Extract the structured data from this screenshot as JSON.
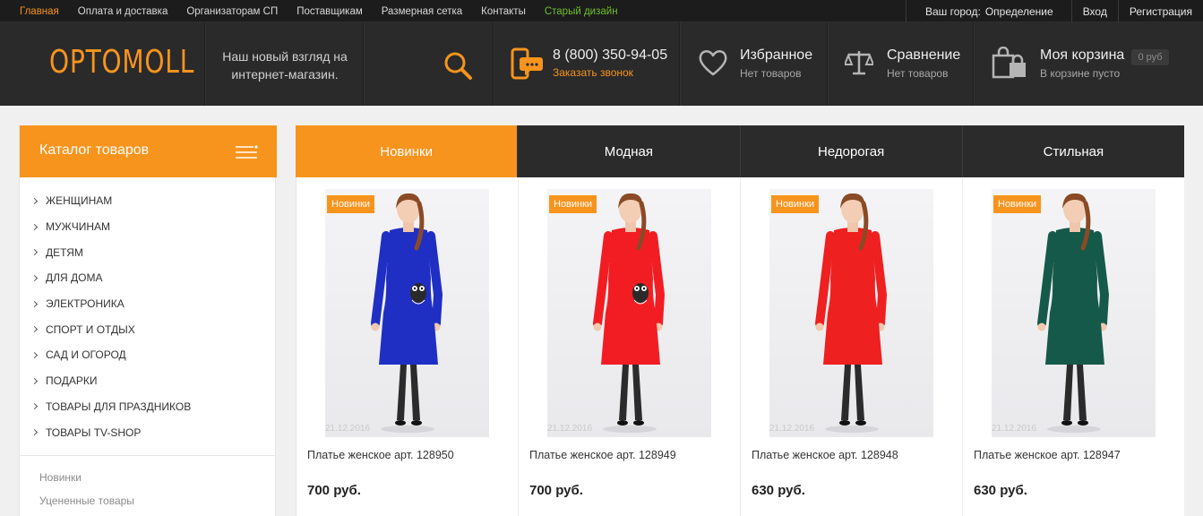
{
  "topbar": {
    "nav": [
      {
        "label": "Главная",
        "state": "active"
      },
      {
        "label": "Оплата и доставка",
        "state": ""
      },
      {
        "label": "Организаторам СП",
        "state": ""
      },
      {
        "label": "Поставщикам",
        "state": ""
      },
      {
        "label": "Размерная сетка",
        "state": ""
      },
      {
        "label": "Контакты",
        "state": ""
      },
      {
        "label": "Старый дизайн",
        "state": "old"
      }
    ],
    "city_label": "Ваш город:",
    "city_value": "Определение",
    "login": "Вход",
    "register": "Регистрация"
  },
  "header": {
    "logo": "OPTOMOLL",
    "slogan": "Наш новый взгляд на интернет-магазин.",
    "phone": "8 (800) 350-94-05",
    "callback": "Заказать звонок",
    "favorites": {
      "title": "Избранное",
      "sub": "Нет товаров"
    },
    "compare": {
      "title": "Сравнение",
      "sub": "Нет товаров"
    },
    "cart": {
      "title": "Моя корзина",
      "sub": "В корзине пусто",
      "total": "0 руб"
    }
  },
  "catalog": {
    "title": "Каталог товаров",
    "items": [
      "ЖЕНЩИНАМ",
      "МУЖЧИНАМ",
      "ДЕТЯМ",
      "ДЛЯ ДОМА",
      "ЭЛЕКТРОНИКА",
      "СПОРТ И ОТДЫХ",
      "САД И ОГОРОД",
      "ПОДАРКИ",
      "ТОВАРЫ ДЛЯ ПРАЗДНИКОВ",
      "ТОВАРЫ TV-SHOP"
    ],
    "links": [
      "Новинки",
      "Уцененные товары"
    ]
  },
  "tabs": [
    {
      "label": "Новинки",
      "active": true
    },
    {
      "label": "Модная",
      "active": false
    },
    {
      "label": "Недорогая",
      "active": false
    },
    {
      "label": "Стильная",
      "active": false
    }
  ],
  "products": [
    {
      "badge": "Новинки",
      "date": "21.12.2016",
      "name": "Платье женское арт. 128950",
      "price": "700 руб.",
      "dress_color": "#1f2fc4",
      "print": "owl"
    },
    {
      "badge": "Новинки",
      "date": "21.12.2016",
      "name": "Платье женское арт. 128949",
      "price": "700 руб.",
      "dress_color": "#f21d22",
      "print": "owl"
    },
    {
      "badge": "Новинки",
      "date": "21.12.2016",
      "name": "Платье женское арт. 128948",
      "price": "630 руб.",
      "dress_color": "#ef2020",
      "print": "none"
    },
    {
      "badge": "Новинки",
      "date": "21.12.2016",
      "name": "Платье женское арт. 128947",
      "price": "630 руб.",
      "dress_color": "#15594a",
      "print": "none"
    }
  ],
  "colors": {
    "accent": "#f7941d",
    "dark": "#2a2a2a",
    "old_design": "#6fbf2c"
  }
}
